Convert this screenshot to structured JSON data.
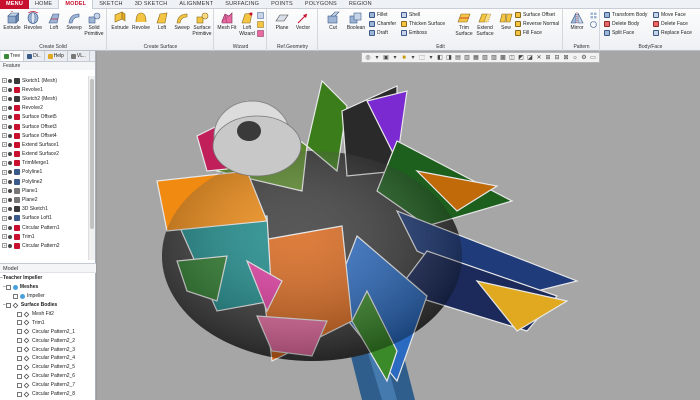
{
  "menubar": {
    "tabs": [
      "MENU",
      "HOME",
      "MODEL",
      "SKETCH",
      "3D SKETCH",
      "ALIGNMENT",
      "SURFACING",
      "POINTS",
      "POLYGONS",
      "REGION"
    ],
    "active": "MODEL"
  },
  "ribbon": {
    "groups": {
      "create_solid": "Create Solid",
      "create_surface": "Create Surface",
      "wizard": "Wizard",
      "ref_geometry": "Ref.Geometry",
      "edit": "Edit",
      "pattern": "Pattern",
      "body_face": "Body/Face"
    },
    "buttons": {
      "extrude": "Extrude",
      "revolve": "Revolve",
      "loft": "Loft",
      "sweep": "Sweep",
      "solid_primitive": "Solid Primitive",
      "extrude2": "Extrude",
      "revolve2": "Revolve",
      "loft2": "Loft",
      "sweep2": "Sweep",
      "surface_primitive": "Surface Primitive",
      "mesh_fit": "Mesh Fit",
      "loft_wizard": "Loft Wizard",
      "plane": "Plane",
      "vector": "Vector",
      "cut": "Cut",
      "boolean": "Boolean",
      "trim_surface": "Trim Surface",
      "extend_surface": "Extend Surface",
      "sew": "Sew",
      "mirror": "Mirror"
    },
    "small": {
      "fillet": "Fillet",
      "chamfer": "Chamfer",
      "draft": "Draft",
      "shell": "Shell",
      "thicken_surface": "Thicken Surface",
      "emboss": "Emboss",
      "surface_offset": "Surface Offset",
      "reverse_normal": "Reverse Normal",
      "fill_face": "Fill Face",
      "transform_body": "Transform Body",
      "delete_body": "Delete Body",
      "split_face": "Split Face",
      "move_face": "Move Face",
      "delete_face": "Delete Face",
      "replace_face": "Replace Face"
    }
  },
  "panel": {
    "tabs": [
      "Tree",
      "Di..",
      "Help",
      "VL.."
    ],
    "feature_header": "Feature",
    "features": [
      "Sketch1 (Mesh)",
      "Revolve1",
      "Sketch2 (Mesh)",
      "Revolve2",
      "Surface Offset5",
      "Surface Offset3",
      "Surface Offset4",
      "Extend Surface1",
      "Extend Surface2",
      "TrimMerge1",
      "Polyline1",
      "Polyline2",
      "Plane1",
      "Plane2",
      "3D Sketch1",
      "Surface Loft1",
      "Circular Pattern1",
      "Trim1",
      "Circular Pattern2"
    ],
    "model_header": "Model",
    "model_root": "Teacher Impeller",
    "meshes_label": "Meshes",
    "impeller_label": "Impeller",
    "surface_bodies_label": "Surface Bodies",
    "bodies": [
      "Mesh Fit2",
      "Trim1",
      "Circular Pattern2_1",
      "Circular Pattern2_2",
      "Circular Pattern2_3",
      "Circular Pattern2_4",
      "Circular Pattern2_5",
      "Circular Pattern2_6",
      "Circular Pattern2_7",
      "Circular Pattern2_8"
    ]
  },
  "colors": {
    "menu_red": "#c8102e",
    "viewport_bg": "#a6a6a6"
  }
}
